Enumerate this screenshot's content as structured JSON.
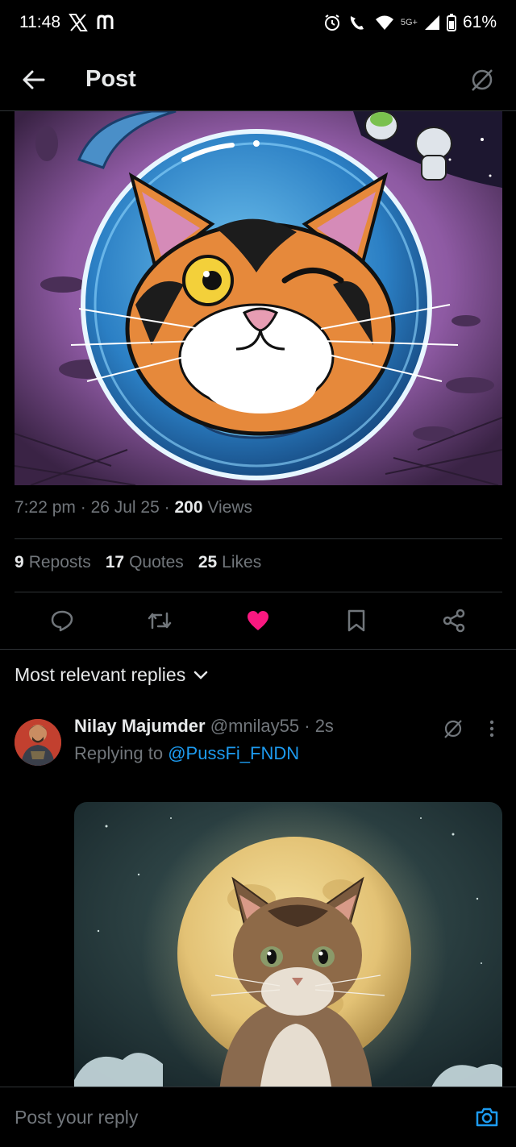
{
  "status_bar": {
    "time": "11:48",
    "network_label": "5G+",
    "battery": "61%"
  },
  "header": {
    "title": "Post"
  },
  "post": {
    "time": "7:22 pm",
    "date": "26 Jul 25",
    "views_count": "200",
    "views_label": "Views",
    "reposts_count": "9",
    "reposts_label": "Reposts",
    "quotes_count": "17",
    "quotes_label": "Quotes",
    "likes_count": "25",
    "likes_label": "Likes",
    "like_color": "#f91880"
  },
  "replies": {
    "sort_label": "Most relevant replies"
  },
  "reply": {
    "name": "Nilay Majumder",
    "handle": "@mnilay55",
    "time": "2s",
    "replying_prefix": "Replying to",
    "replying_to": "@PussFi_FNDN"
  },
  "composer": {
    "placeholder": "Post your reply"
  },
  "colors": {
    "accent": "#1d9bf0",
    "muted": "#71767b",
    "text": "#e7e9ea"
  }
}
